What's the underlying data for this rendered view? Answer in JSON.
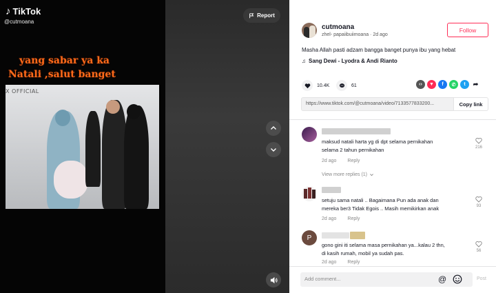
{
  "app": {
    "logo_text": "TikTok",
    "handle_watermark": "@cutmoana"
  },
  "video": {
    "overlay_lines": [
      "yang sabar ya ka",
      "Natali ,salut banget"
    ],
    "frame_watermark": "X OFFICIAL",
    "report_label": "Report"
  },
  "author": {
    "name": "cutmoana",
    "subline": "zhel- papaiibuiimoana · 2d ago",
    "follow_label": "Follow"
  },
  "post": {
    "caption": "Masha Allah pasti adzam bangga banget punya ibu yang hebat",
    "music": "Sang Dewi - Lyodra & Andi Rianto",
    "likes": "10.4K",
    "comments": "61",
    "link": "https://www.tiktok.com/@cutmoana/video/7133577833200...",
    "copy_label": "Copy link"
  },
  "comments": [
    {
      "text_lines": [
        "maksud natali harta yg di dpt selama pernikahan",
        "selama 2 tahun pernikahan"
      ],
      "time": "2d ago",
      "reply": "Reply",
      "likes": "216"
    },
    {
      "text_lines": [
        "setuju sama natali .. Bagaimana Pun ada anak dan",
        "mereka ber3 Tidak Egois .. Masih memikirkan anak"
      ],
      "time": "2d ago",
      "reply": "Reply",
      "likes": "93"
    },
    {
      "avatar_letter": "P",
      "text_lines": [
        "gono gini iti selama masa pernikahan ya...kalau 2 thn,",
        "di kasih rumah, mobil ya sudah pas."
      ],
      "time": "2d ago",
      "reply": "Reply",
      "likes": "56"
    }
  ],
  "view_more": "View more replies (1)",
  "composer": {
    "placeholder": "Add comment...",
    "post_label": "Post"
  },
  "colors": {
    "accent": "#fe2c55",
    "overlay_text": "#ff6a1a"
  }
}
